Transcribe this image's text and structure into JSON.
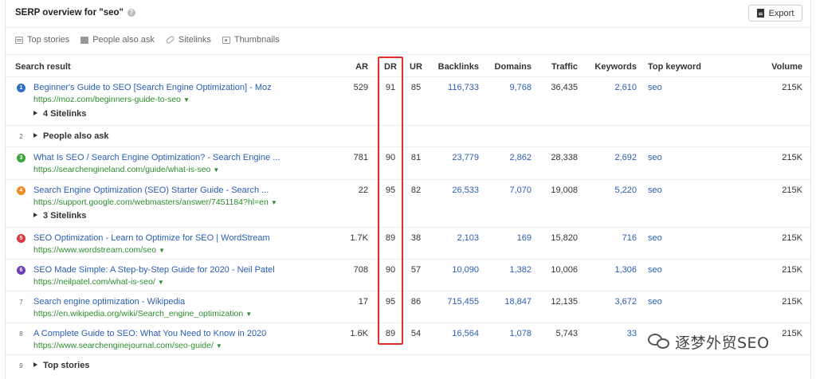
{
  "header": {
    "title": "SERP overview for \"seo\"",
    "info_icon": "?",
    "export_label": "Export"
  },
  "features": [
    {
      "label": "Top stories",
      "icon": "top-stories-icon"
    },
    {
      "label": "People also ask",
      "icon": "people-also-ask-icon"
    },
    {
      "label": "Sitelinks",
      "icon": "link-icon"
    },
    {
      "label": "Thumbnails",
      "icon": "image-icon"
    }
  ],
  "columns": {
    "result": "Search result",
    "ar": "AR",
    "dr": "DR",
    "ur": "UR",
    "backlinks": "Backlinks",
    "domains": "Domains",
    "traffic": "Traffic",
    "keywords": "Keywords",
    "top_keyword": "Top keyword",
    "volume": "Volume"
  },
  "rows": [
    {
      "pos": "1",
      "badge_color": "#2f6fc4",
      "title": "Beginner's Guide to SEO [Search Engine Optimization] - Moz",
      "url": "https://moz.com/beginners-guide-to-seo",
      "ar": "529",
      "dr": "91",
      "ur": "85",
      "backlinks": "116,733",
      "domains": "9,768",
      "traffic": "36,435",
      "keywords": "2,610",
      "top_keyword": "seo",
      "volume": "215K",
      "sub": "4 Sitelinks"
    },
    {
      "pos": "2",
      "paa": "People also ask"
    },
    {
      "pos": "3",
      "badge_color": "#3aa53a",
      "title": "What Is SEO / Search Engine Optimization? - Search Engine ...",
      "url": "https://searchengineland.com/guide/what-is-seo",
      "ar": "781",
      "dr": "90",
      "ur": "81",
      "backlinks": "23,779",
      "domains": "2,862",
      "traffic": "28,338",
      "keywords": "2,692",
      "top_keyword": "seo",
      "volume": "215K"
    },
    {
      "pos": "4",
      "badge_color": "#f08a24",
      "title": "Search Engine Optimization (SEO) Starter Guide - Search ...",
      "url": "https://support.google.com/webmasters/answer/7451184?hl=en",
      "ar": "22",
      "dr": "95",
      "ur": "82",
      "backlinks": "26,533",
      "domains": "7,070",
      "traffic": "19,008",
      "keywords": "5,220",
      "top_keyword": "seo",
      "volume": "215K",
      "sub": "3 Sitelinks"
    },
    {
      "pos": "5",
      "badge_color": "#d93b3b",
      "title": "SEO Optimization - Learn to Optimize for SEO | WordStream",
      "url": "https://www.wordstream.com/seo",
      "ar": "1.7K",
      "dr": "89",
      "ur": "38",
      "backlinks": "2,103",
      "domains": "169",
      "traffic": "15,820",
      "keywords": "716",
      "top_keyword": "seo",
      "volume": "215K"
    },
    {
      "pos": "6",
      "badge_color": "#6a3fb8",
      "title": "SEO Made Simple: A Step-by-Step Guide for 2020 - Neil Patel",
      "url": "https://neilpatel.com/what-is-seo/",
      "ar": "708",
      "dr": "90",
      "ur": "57",
      "backlinks": "10,090",
      "domains": "1,382",
      "traffic": "10,006",
      "keywords": "1,306",
      "top_keyword": "seo",
      "volume": "215K"
    },
    {
      "pos": "7",
      "title": "Search engine optimization - Wikipedia",
      "url": "https://en.wikipedia.org/wiki/Search_engine_optimization",
      "ar": "17",
      "dr": "95",
      "ur": "86",
      "backlinks": "715,455",
      "domains": "18,847",
      "traffic": "12,135",
      "keywords": "3,672",
      "top_keyword": "seo",
      "volume": "215K"
    },
    {
      "pos": "8",
      "title": "A Complete Guide to SEO: What You Need to Know in 2020",
      "url": "https://www.searchenginejournal.com/seo-guide/",
      "ar": "1.6K",
      "dr": "89",
      "ur": "54",
      "backlinks": "16,564",
      "domains": "1,078",
      "traffic": "5,743",
      "keywords": "33",
      "top_keyword": "",
      "volume": "215K"
    },
    {
      "pos": "9",
      "paa": "Top stories"
    }
  ],
  "watermark": "逐梦外贸SEO"
}
